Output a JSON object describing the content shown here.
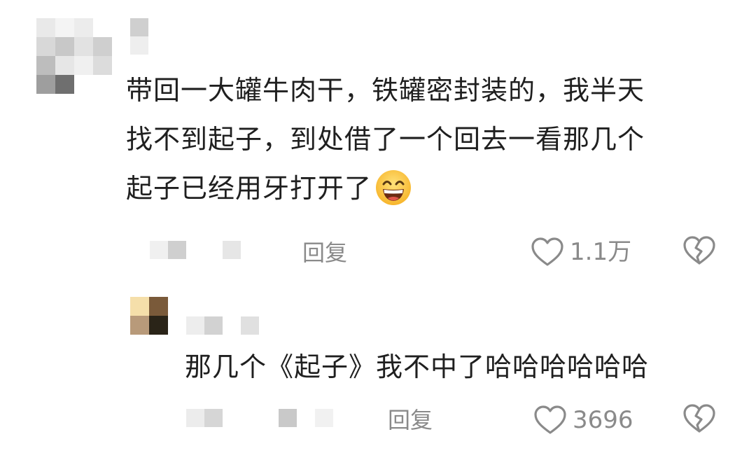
{
  "comments": [
    {
      "text_lines": [
        "带回一大罐牛肉干，铁罐密封装的，我半天",
        "找不到起子，到处借了一个回去一看那几个",
        "起子已经用牙打开了"
      ],
      "emoji": "grinning-face-smiling-eyes",
      "reply_label": "回复",
      "like_count": "1.1万"
    },
    {
      "text": "那几个《起子》我不中了哈哈哈哈哈哈",
      "reply_label": "回复",
      "like_count": "3696"
    }
  ],
  "icons": {
    "like": "heart-outline-icon",
    "dislike": "broken-heart-icon"
  },
  "colors": {
    "text": "#1f1f1f",
    "meta": "#8a8a8a",
    "background": "#ffffff"
  }
}
